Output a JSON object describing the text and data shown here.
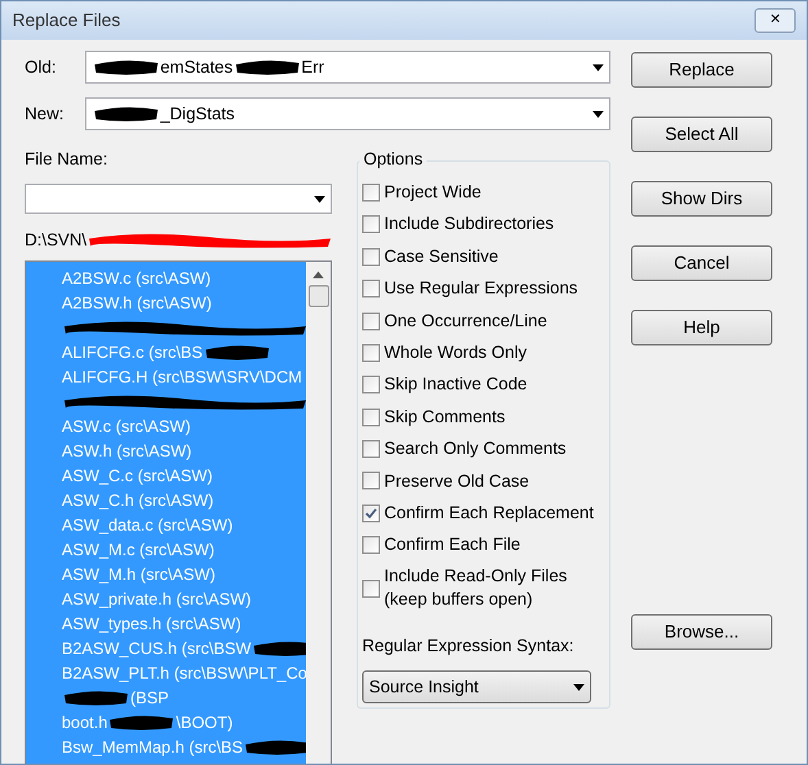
{
  "window": {
    "title": "Replace Files",
    "close": "✕"
  },
  "old": {
    "label": "Old:",
    "parts": [
      {
        "kind": "redaction",
        "color": "#000000"
      },
      {
        "kind": "text",
        "text": "emStates"
      },
      {
        "kind": "redaction",
        "color": "#000000"
      },
      {
        "kind": "text",
        "text": "Err"
      }
    ]
  },
  "new": {
    "label": "New:",
    "parts": [
      {
        "kind": "redaction",
        "color": "#000000"
      },
      {
        "kind": "text",
        "text": "_DigStats"
      }
    ]
  },
  "file_name": {
    "label": "File Name:"
  },
  "path": {
    "parts": [
      {
        "kind": "text",
        "text": "D:\\SVN\\"
      },
      {
        "kind": "redaction",
        "color": "#ff0000"
      }
    ]
  },
  "files": [
    {
      "selected": true,
      "parts": [
        {
          "kind": "text",
          "text": "A2BSW.c (src\\ASW)"
        }
      ]
    },
    {
      "selected": true,
      "parts": [
        {
          "kind": "text",
          "text": "A2BSW.h (src\\ASW)"
        }
      ]
    },
    {
      "selected": true,
      "parts": [
        {
          "kind": "redaction",
          "color": "#000000"
        }
      ]
    },
    {
      "selected": true,
      "parts": [
        {
          "kind": "text",
          "text": "ALIFCFG.c (src\\BS"
        },
        {
          "kind": "redaction",
          "color": "#000000"
        }
      ]
    },
    {
      "selected": true,
      "parts": [
        {
          "kind": "text",
          "text": "ALIFCFG.H (src\\BSW\\SRV\\DCM"
        }
      ]
    },
    {
      "selected": true,
      "parts": [
        {
          "kind": "redaction",
          "color": "#000000"
        }
      ]
    },
    {
      "selected": true,
      "parts": [
        {
          "kind": "text",
          "text": "ASW.c (src\\ASW)"
        }
      ]
    },
    {
      "selected": true,
      "parts": [
        {
          "kind": "text",
          "text": "ASW.h (src\\ASW)"
        }
      ]
    },
    {
      "selected": true,
      "parts": [
        {
          "kind": "text",
          "text": "ASW_C.c (src\\ASW)"
        }
      ]
    },
    {
      "selected": true,
      "parts": [
        {
          "kind": "text",
          "text": "ASW_C.h (src\\ASW)"
        }
      ]
    },
    {
      "selected": true,
      "parts": [
        {
          "kind": "text",
          "text": "ASW_data.c (src\\ASW)"
        }
      ]
    },
    {
      "selected": true,
      "parts": [
        {
          "kind": "text",
          "text": "ASW_M.c (src\\ASW)"
        }
      ]
    },
    {
      "selected": true,
      "parts": [
        {
          "kind": "text",
          "text": "ASW_M.h (src\\ASW)"
        }
      ]
    },
    {
      "selected": true,
      "parts": [
        {
          "kind": "text",
          "text": "ASW_private.h (src\\ASW)"
        }
      ]
    },
    {
      "selected": true,
      "parts": [
        {
          "kind": "text",
          "text": "ASW_types.h (src\\ASW)"
        }
      ]
    },
    {
      "selected": true,
      "parts": [
        {
          "kind": "text",
          "text": "B2ASW_CUS.h (src\\BSW"
        },
        {
          "kind": "redaction",
          "color": "#000000"
        }
      ]
    },
    {
      "selected": true,
      "parts": [
        {
          "kind": "text",
          "text": "B2ASW_PLT.h (src\\BSW\\PLT_Co"
        }
      ]
    },
    {
      "selected": true,
      "parts": [
        {
          "kind": "redaction",
          "color": "#000000"
        },
        {
          "kind": "text",
          "text": "(BSP"
        }
      ]
    },
    {
      "selected": true,
      "parts": [
        {
          "kind": "text",
          "text": "boot.h"
        },
        {
          "kind": "redaction",
          "color": "#000000"
        },
        {
          "kind": "text",
          "text": "\\BOOT)"
        }
      ]
    },
    {
      "selected": true,
      "parts": [
        {
          "kind": "text",
          "text": "Bsw_MemMap.h (src\\BS"
        },
        {
          "kind": "redaction",
          "color": "#000000"
        }
      ]
    }
  ],
  "options": {
    "title": "Options",
    "items": [
      {
        "label": "Project Wide",
        "checked": false
      },
      {
        "label": "Include Subdirectories",
        "checked": false
      },
      {
        "label": "Case Sensitive",
        "checked": false
      },
      {
        "label": "Use Regular Expressions",
        "checked": false
      },
      {
        "label": "One Occurrence/Line",
        "checked": false
      },
      {
        "label": "Whole Words Only",
        "checked": false
      },
      {
        "label": "Skip Inactive Code",
        "checked": false
      },
      {
        "label": "Skip Comments",
        "checked": false
      },
      {
        "label": "Search Only Comments",
        "checked": false
      },
      {
        "label": "Preserve Old Case",
        "checked": false
      },
      {
        "label": "Confirm Each Replacement",
        "checked": true
      },
      {
        "label": "Confirm Each File",
        "checked": false
      },
      {
        "label": "Include Read-Only Files (keep buffers open)",
        "checked": false
      }
    ],
    "syntax_label": "Regular Expression Syntax:",
    "syntax_value": "Source Insight"
  },
  "buttons": [
    "Replace",
    "Select All",
    "Show Dirs",
    "Cancel",
    "Help"
  ],
  "browse": "Browse..."
}
